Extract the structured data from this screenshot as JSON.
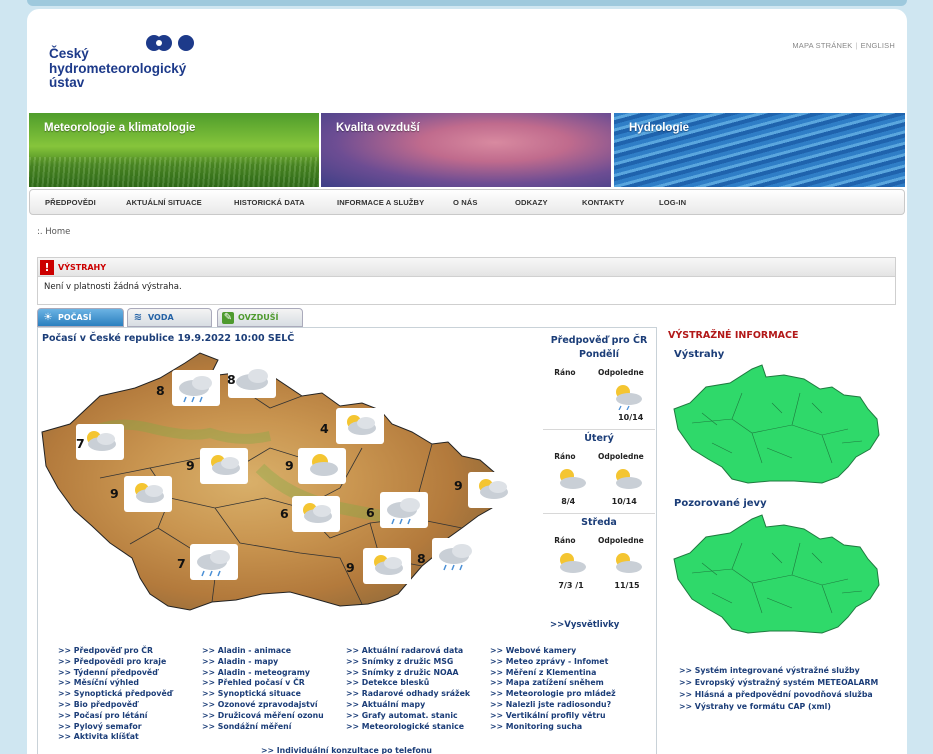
{
  "header": {
    "logo_lines": [
      "Český",
      "hydrometeorologický",
      "ústav"
    ],
    "links": [
      "MAPA STRÁNEK",
      "ENGLISH"
    ]
  },
  "banners": [
    "Meteorologie a klimatologie",
    "Kvalita ovzduší",
    "Hydrologie"
  ],
  "nav": [
    "PŘEDPOVĚDI",
    "AKTUÁLNÍ SITUACE",
    "HISTORICKÁ DATA",
    "INFORMACE A SLUŽBY",
    "O NÁS",
    "ODKAZY",
    "KONTAKTY",
    "LOG-IN"
  ],
  "breadcrumb": ":. Home",
  "warnings": {
    "title": "VÝSTRAHY",
    "text": "Není v platnosti žádná výstraha."
  },
  "tabs": [
    "POČASÍ",
    "VODA",
    "OVZDUŠÍ"
  ],
  "weather": {
    "title": "Počasí v České republice 19.9.2022 10:00 SELČ",
    "map_values": [
      "8",
      "8",
      "7",
      "4",
      "9",
      "9",
      "9",
      "9",
      "6",
      "6",
      "7",
      "9",
      "8"
    ]
  },
  "forecast": {
    "title": "Předpověď pro ČR",
    "morning_label": "Ráno",
    "afternoon_label": "Odpoledne",
    "days": [
      {
        "name": "Pondělí",
        "morning": "",
        "afternoon": "10/14"
      },
      {
        "name": "Úterý",
        "morning": "8/4",
        "afternoon": "10/14"
      },
      {
        "name": "Středa",
        "morning": "7/3 /1",
        "afternoon": "11/15"
      }
    ],
    "legend_link": ">>Vysvětlivky"
  },
  "links": {
    "col1": [
      ">> Předpověď pro ČR",
      ">> Předpovědi pro kraje",
      ">> Týdenní předpověď",
      ">> Měsíční výhled",
      ">> Synoptická předpověď",
      ">> Bio předpověď",
      ">> Počasí pro létání",
      ">> Pylový semafor",
      ">> Aktivita klíšťat"
    ],
    "col2": [
      ">> Aladin - animace",
      ">> Aladin - mapy",
      ">> Aladin - meteogramy",
      ">> Přehled počasí v ČR",
      ">> Synoptická situace",
      ">> Ozonové zpravodajství",
      ">> Družicová měření ozonu",
      ">> Sondážní měření"
    ],
    "col3": [
      ">> Aktuální radarová data",
      ">> Snímky z družic MSG",
      ">> Snímky z družic NOAA",
      ">> Detekce blesků",
      ">> Radarové odhady srážek",
      ">> Aktuální mapy",
      ">> Grafy automat. stanic",
      ">> Meteorologické stanice"
    ],
    "col4": [
      ">> Webové kamery",
      ">> Meteo zprávy - Infomet",
      ">> Měření z Klementina",
      ">> Mapa zatížení sněhem",
      ">> Meteorologie pro mládež",
      ">> Nalezli jste radiosondu?",
      ">> Vertikální profily větru",
      ">> Monitoring sucha"
    ],
    "consult": ">> Individuální konzultace po telefonu"
  },
  "right": {
    "title": "VÝSTRAŽNÉ INFORMACE",
    "map1_title": "Výstrahy",
    "map2_title": "Pozorované jevy",
    "links": [
      ">> Systém integrované výstražné služby",
      ">> Evropský výstražný systém METEOALARM",
      ">> Hlásná a předpovědní povodňová služba",
      ">> Výstrahy ve formátu CAP (xml)"
    ]
  },
  "colors": {
    "accent_red": "#b21818",
    "link_blue": "#1b3d78",
    "map_green": "#2fd96a"
  },
  "icons": [
    "chmu-logo-icon",
    "warning-icon",
    "sun-icon",
    "water-icon",
    "leaf-icon",
    "cloud-icon",
    "partly-cloudy-icon",
    "rain-icon"
  ]
}
